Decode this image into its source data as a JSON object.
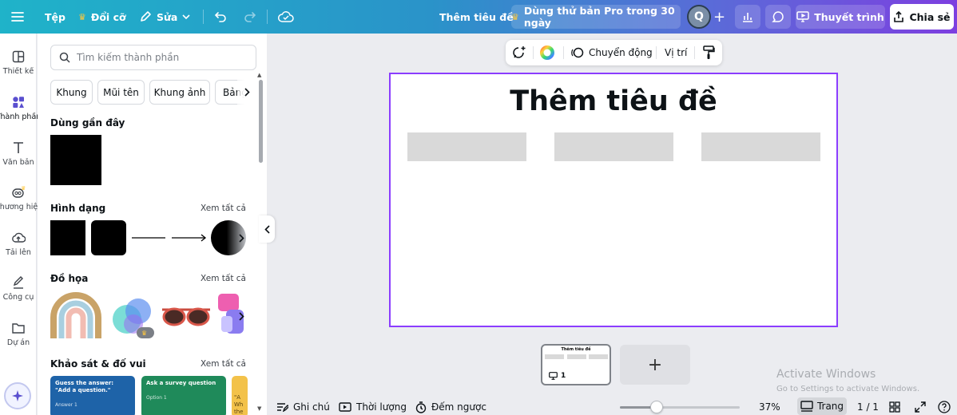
{
  "topbar": {
    "file_label": "Tệp",
    "resize_label": "Đổi cỡ",
    "edit_label": "Sửa",
    "doc_title": "Thêm tiêu đề",
    "pro_trial_label": "Dùng thử bản Pro trong 30 ngày",
    "avatar_initial": "Q",
    "present_label": "Thuyết trình",
    "share_label": "Chia sẻ",
    "accent_color": "#7d3fe0"
  },
  "rail": {
    "items": [
      {
        "label": "Thiết kế",
        "icon": "layout-icon"
      },
      {
        "label": "Thành phần",
        "icon": "elements-icon"
      },
      {
        "label": "Văn bản",
        "icon": "text-icon"
      },
      {
        "label": "Thương hiệu",
        "icon": "brand-icon"
      },
      {
        "label": "Tải lên",
        "icon": "upload-icon"
      },
      {
        "label": "Công cụ",
        "icon": "draw-icon"
      },
      {
        "label": "Dự án",
        "icon": "folder-icon"
      }
    ]
  },
  "panel": {
    "search_placeholder": "Tìm kiếm thành phần",
    "chips": [
      "Khung",
      "Mũi tên",
      "Khung ảnh",
      "Bảng"
    ],
    "recent_title": "Dùng gần đây",
    "shapes_title": "Hình dạng",
    "graphics_title": "Đồ họa",
    "survey_title": "Khảo sát & đố vui",
    "see_all": "Xem tất cả",
    "survey_cards": [
      {
        "title": "Guess the answer: \"Add a question.\"",
        "sub": "Answer 1",
        "color": "#1e63a8"
      },
      {
        "title": "Ask a survey question",
        "sub": "Option 1",
        "color": "#1f8a5a"
      },
      {
        "title": "\"A\nWh\nthe",
        "sub": "",
        "color": "#f3c24a"
      }
    ]
  },
  "context_toolbar": {
    "animate_label": "Chuyển động",
    "position_label": "Vị trí"
  },
  "canvas": {
    "title": "Thêm tiêu đề",
    "placeholders": 3
  },
  "pages": {
    "thumb_title": "Thêm tiêu đề",
    "thumb_number": "1",
    "add_label": "+"
  },
  "watermark": {
    "line1": "Activate Windows",
    "line2": "Go to Settings to activate Windows."
  },
  "bottombar": {
    "notes_label": "Ghi chú",
    "duration_label": "Thời lượng",
    "timer_label": "Đếm ngược",
    "zoom": "37%",
    "zoom_level": 0.37,
    "pages_label": "Trang",
    "page_count": "1 / 1"
  }
}
